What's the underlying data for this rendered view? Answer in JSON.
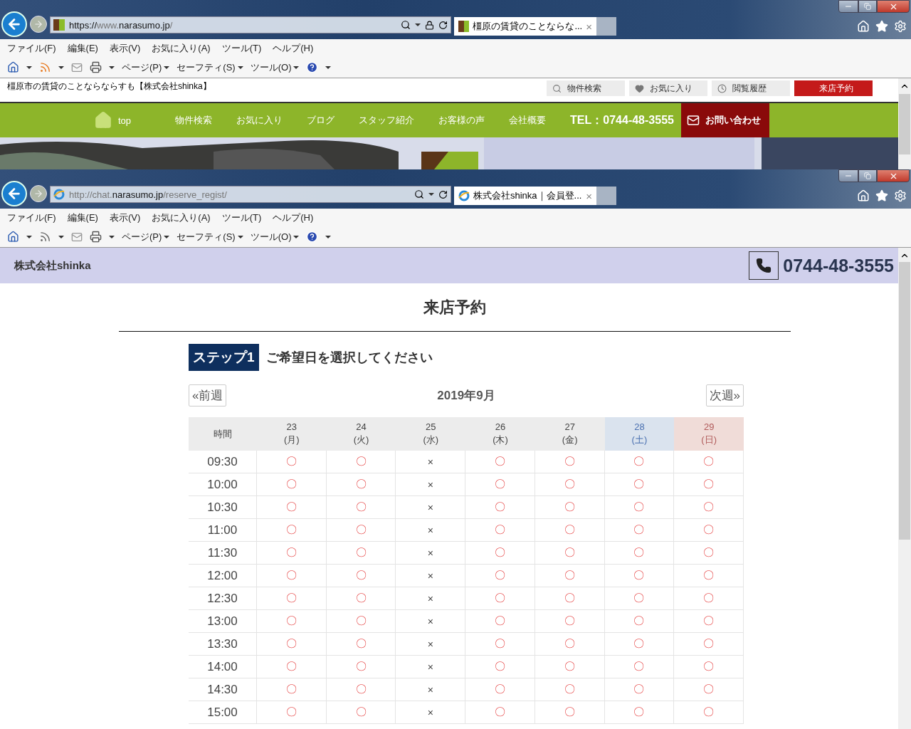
{
  "windows": [
    {
      "url": [
        {
          "text": "https://",
          "emphasis": true
        },
        {
          "text": "www.",
          "emphasis": false
        },
        {
          "text": "narasumo.jp",
          "emphasis": true
        },
        {
          "text": "/",
          "emphasis": false
        }
      ],
      "secure": true,
      "favicon": {
        "kind": "site"
      },
      "tab_title": "橿原の賃貸のことならな...",
      "tab_close": "×",
      "menu": [
        "ファイル(F)",
        "編集(E)",
        "表示(V)",
        "お気に入り(A)",
        "ツール(T)",
        "ヘルプ(H)"
      ],
      "toolbar": [
        "ページ(P)",
        "セーフティ(S)",
        "ツール(O)"
      ]
    },
    {
      "url": [
        {
          "text": "http://chat.",
          "emphasis": false
        },
        {
          "text": "narasumo.jp",
          "emphasis": true
        },
        {
          "text": "/reserve_regist/",
          "emphasis": false
        }
      ],
      "secure": false,
      "favicon": {
        "kind": "ie"
      },
      "tab_title": "株式会社shinka｜会員登...",
      "tab_close": "×",
      "menu": [
        "ファイル(F)",
        "編集(E)",
        "表示(V)",
        "お気に入り(A)",
        "ツール(T)",
        "ヘルプ(H)"
      ],
      "toolbar": [
        "ページ(P)",
        "セーフティ(S)",
        "ツール(O)"
      ]
    }
  ],
  "site": {
    "tagline": "橿原市の賃貸のことならならすも【株式会社shinka】",
    "utility_links": [
      {
        "kind": "search",
        "label": "物件検索"
      },
      {
        "kind": "heart",
        "label": "お気に入り"
      },
      {
        "kind": "clock",
        "label": "閲覧履歴"
      },
      {
        "kind": "reserve",
        "label": "来店予約"
      }
    ],
    "nav": [
      {
        "kind": "home",
        "label": "top"
      },
      {
        "kind": "link",
        "label": "物件検索"
      },
      {
        "kind": "link",
        "label": "お気に入り"
      },
      {
        "kind": "link",
        "label": "ブログ"
      },
      {
        "kind": "link",
        "label": "スタッフ紹介"
      },
      {
        "kind": "link",
        "label": "お客様の声"
      },
      {
        "kind": "link",
        "label": "会社概要"
      },
      {
        "kind": "tel",
        "label": "TEL：0744-48-3555"
      },
      {
        "kind": "contact",
        "label": "お問い合わせ"
      }
    ]
  },
  "reserve": {
    "company": "株式会社shinka",
    "phone": "0744-48-3555",
    "title": "来店予約",
    "step_badge": "ステップ1",
    "step_text": "ご希望日を選択してください",
    "prev": "«前週",
    "month": "2019年9月",
    "next": "次週»",
    "time_header": "時間",
    "days": [
      {
        "date": "23",
        "weekday": "(月)",
        "kind": "weekday"
      },
      {
        "date": "24",
        "weekday": "(火)",
        "kind": "weekday"
      },
      {
        "date": "25",
        "weekday": "(水)",
        "kind": "weekday"
      },
      {
        "date": "26",
        "weekday": "(木)",
        "kind": "weekday"
      },
      {
        "date": "27",
        "weekday": "(金)",
        "kind": "weekday"
      },
      {
        "date": "28",
        "weekday": "(土)",
        "kind": "saturday"
      },
      {
        "date": "29",
        "weekday": "(日)",
        "kind": "sunday"
      }
    ],
    "rows": [
      {
        "time": "09:30",
        "cells": [
          "〇",
          "〇",
          "×",
          "〇",
          "〇",
          "〇",
          "〇"
        ]
      },
      {
        "time": "10:00",
        "cells": [
          "〇",
          "〇",
          "×",
          "〇",
          "〇",
          "〇",
          "〇"
        ]
      },
      {
        "time": "10:30",
        "cells": [
          "〇",
          "〇",
          "×",
          "〇",
          "〇",
          "〇",
          "〇"
        ]
      },
      {
        "time": "11:00",
        "cells": [
          "〇",
          "〇",
          "×",
          "〇",
          "〇",
          "〇",
          "〇"
        ]
      },
      {
        "time": "11:30",
        "cells": [
          "〇",
          "〇",
          "×",
          "〇",
          "〇",
          "〇",
          "〇"
        ]
      },
      {
        "time": "12:00",
        "cells": [
          "〇",
          "〇",
          "×",
          "〇",
          "〇",
          "〇",
          "〇"
        ]
      },
      {
        "time": "12:30",
        "cells": [
          "〇",
          "〇",
          "×",
          "〇",
          "〇",
          "〇",
          "〇"
        ]
      },
      {
        "time": "13:00",
        "cells": [
          "〇",
          "〇",
          "×",
          "〇",
          "〇",
          "〇",
          "〇"
        ]
      },
      {
        "time": "13:30",
        "cells": [
          "〇",
          "〇",
          "×",
          "〇",
          "〇",
          "〇",
          "〇"
        ]
      },
      {
        "time": "14:00",
        "cells": [
          "〇",
          "〇",
          "×",
          "〇",
          "〇",
          "〇",
          "〇"
        ]
      },
      {
        "time": "14:30",
        "cells": [
          "〇",
          "〇",
          "×",
          "〇",
          "〇",
          "〇",
          "〇"
        ]
      },
      {
        "time": "15:00",
        "cells": [
          "〇",
          "〇",
          "×",
          "〇",
          "〇",
          "〇",
          "〇"
        ]
      }
    ],
    "available": [
      [
        true,
        true,
        false,
        true,
        true,
        true,
        true
      ],
      [
        true,
        true,
        false,
        true,
        true,
        true,
        true
      ],
      [
        true,
        true,
        false,
        true,
        true,
        true,
        true
      ],
      [
        true,
        true,
        false,
        true,
        true,
        true,
        true
      ],
      [
        true,
        true,
        false,
        true,
        true,
        true,
        true
      ],
      [
        true,
        true,
        false,
        true,
        true,
        true,
        true
      ],
      [
        true,
        true,
        false,
        true,
        true,
        true,
        true
      ],
      [
        true,
        true,
        false,
        true,
        true,
        true,
        true
      ],
      [
        true,
        true,
        false,
        true,
        true,
        true,
        true
      ],
      [
        true,
        true,
        false,
        true,
        true,
        true,
        true
      ],
      [
        true,
        true,
        false,
        true,
        true,
        true,
        true
      ],
      [
        true,
        true,
        false,
        true,
        true,
        true,
        true
      ]
    ]
  }
}
